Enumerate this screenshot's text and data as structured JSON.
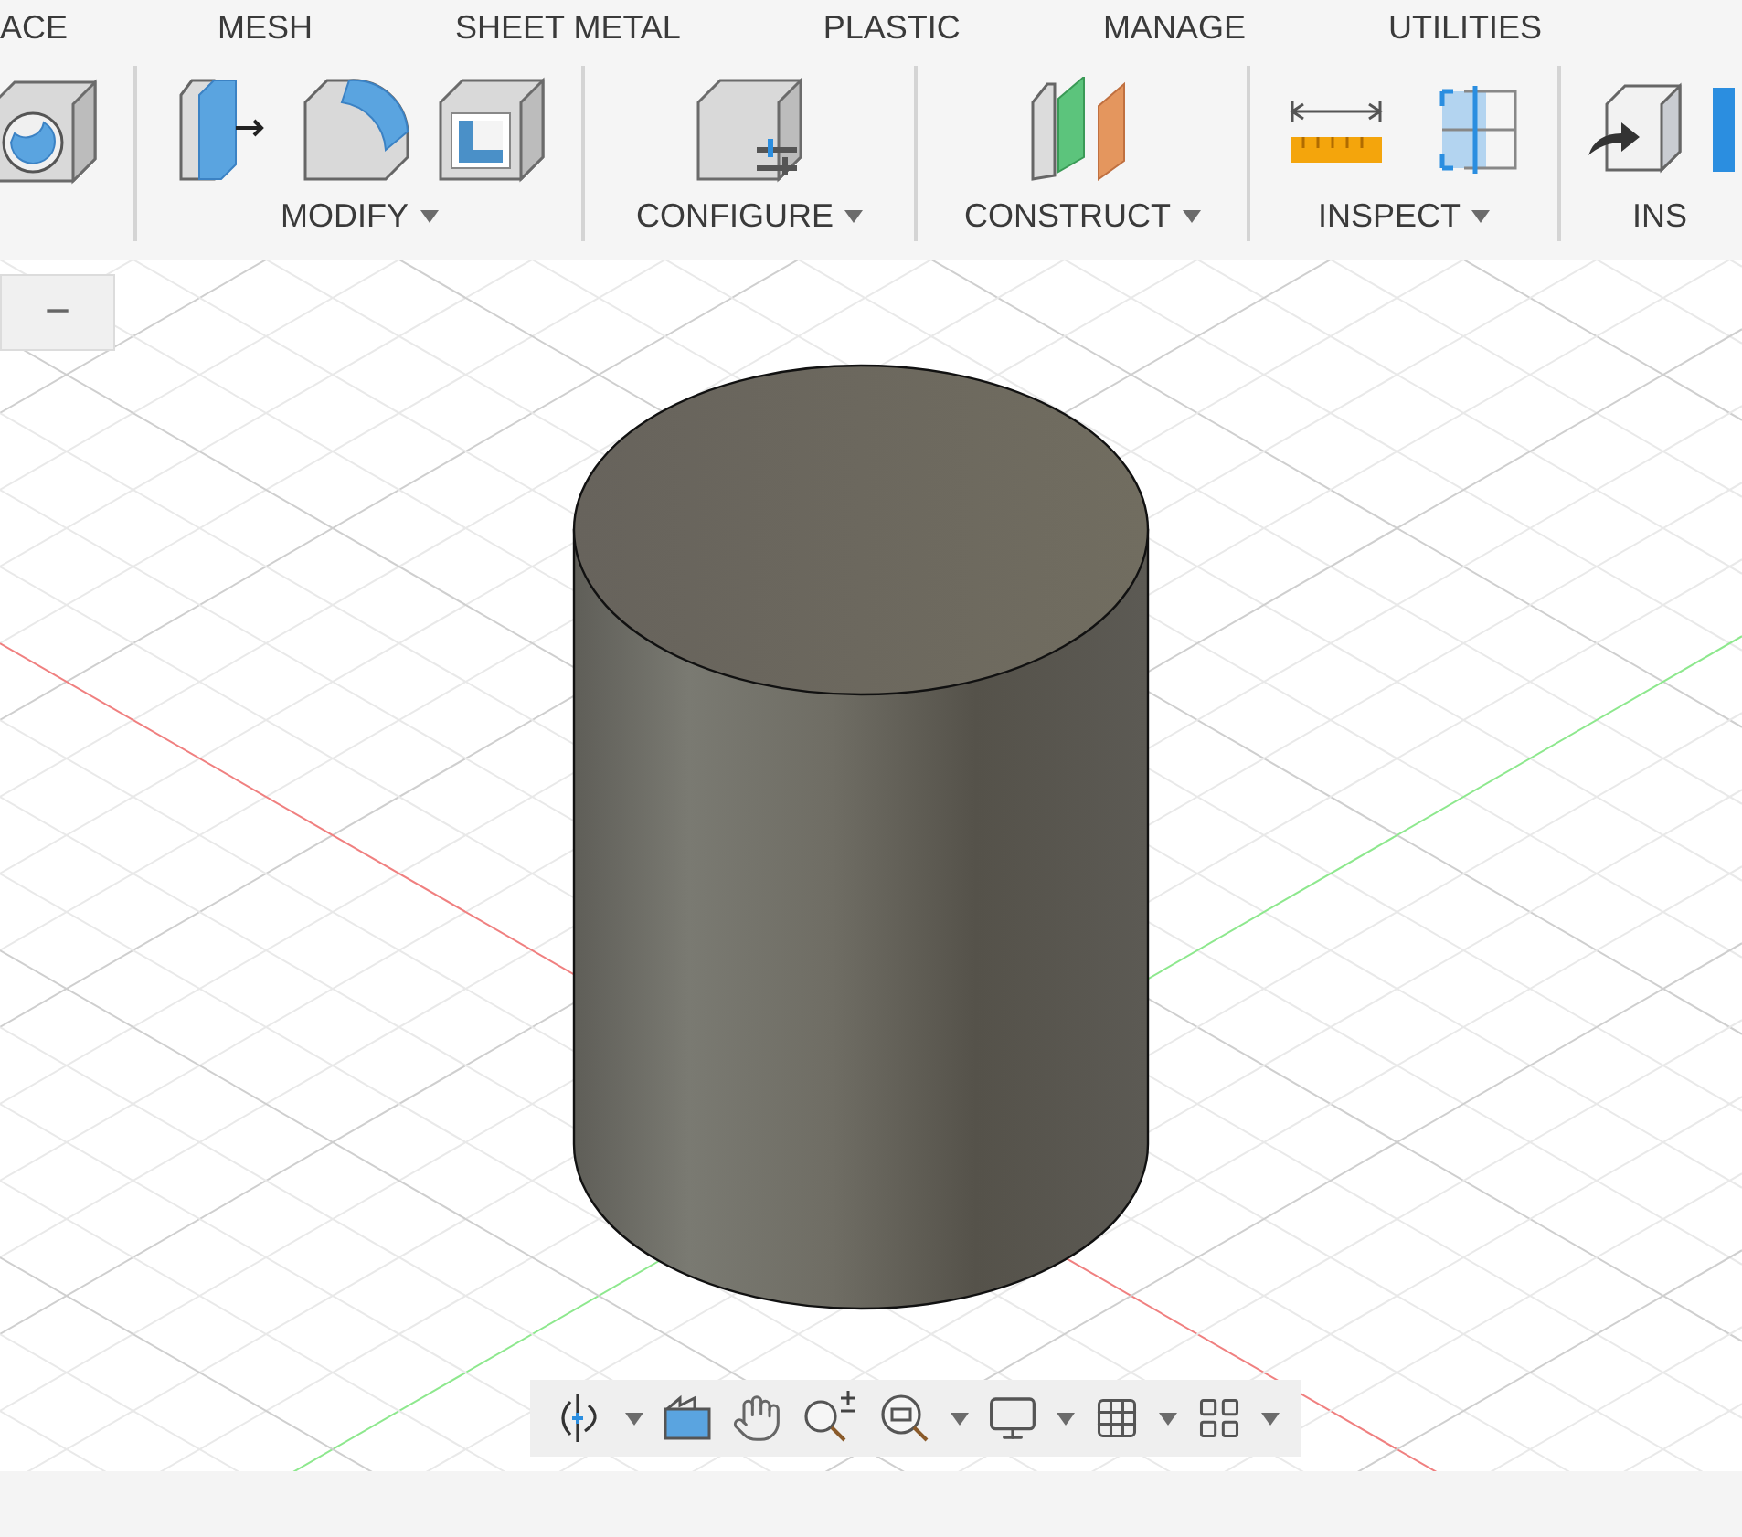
{
  "tabs": [
    {
      "label": "ACE"
    },
    {
      "label": "MESH"
    },
    {
      "label": "SHEET METAL"
    },
    {
      "label": "PLASTIC"
    },
    {
      "label": "MANAGE"
    },
    {
      "label": "UTILITIES"
    }
  ],
  "toolbar": [
    {
      "kind": "solid"
    },
    {
      "kind": "modify",
      "label": "MODIFY",
      "dropdown": true
    },
    {
      "kind": "configure",
      "label": "CONFIGURE",
      "dropdown": true
    },
    {
      "kind": "construct",
      "label": "CONSTRUCT",
      "dropdown": true
    },
    {
      "kind": "inspect",
      "label": "INSPECT",
      "dropdown": true
    },
    {
      "kind": "insert",
      "label": "INS",
      "dropdown": false
    }
  ],
  "viewport": {
    "zoom_button": "−"
  }
}
